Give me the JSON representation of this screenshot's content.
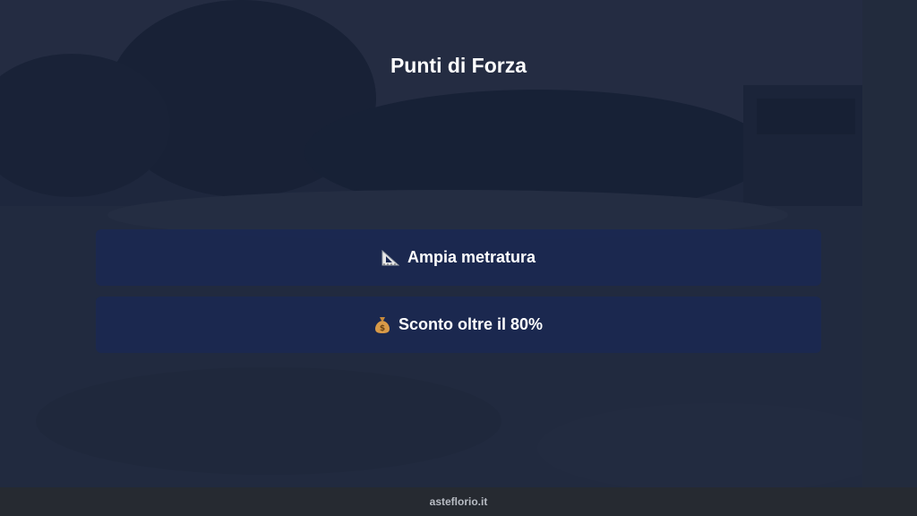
{
  "slide": {
    "title": "Punti di Forza"
  },
  "features": [
    {
      "icon": "triangular-ruler-icon",
      "label": "Ampia metratura"
    },
    {
      "icon": "money-bag-icon",
      "label": "Sconto oltre il 80%"
    }
  ],
  "footer": {
    "text": "asteflorio.it"
  },
  "colors": {
    "card_background": "#1a2852",
    "text": "#ffffff",
    "footer_background": "#262a31",
    "footer_text": "#b8bcc4"
  }
}
